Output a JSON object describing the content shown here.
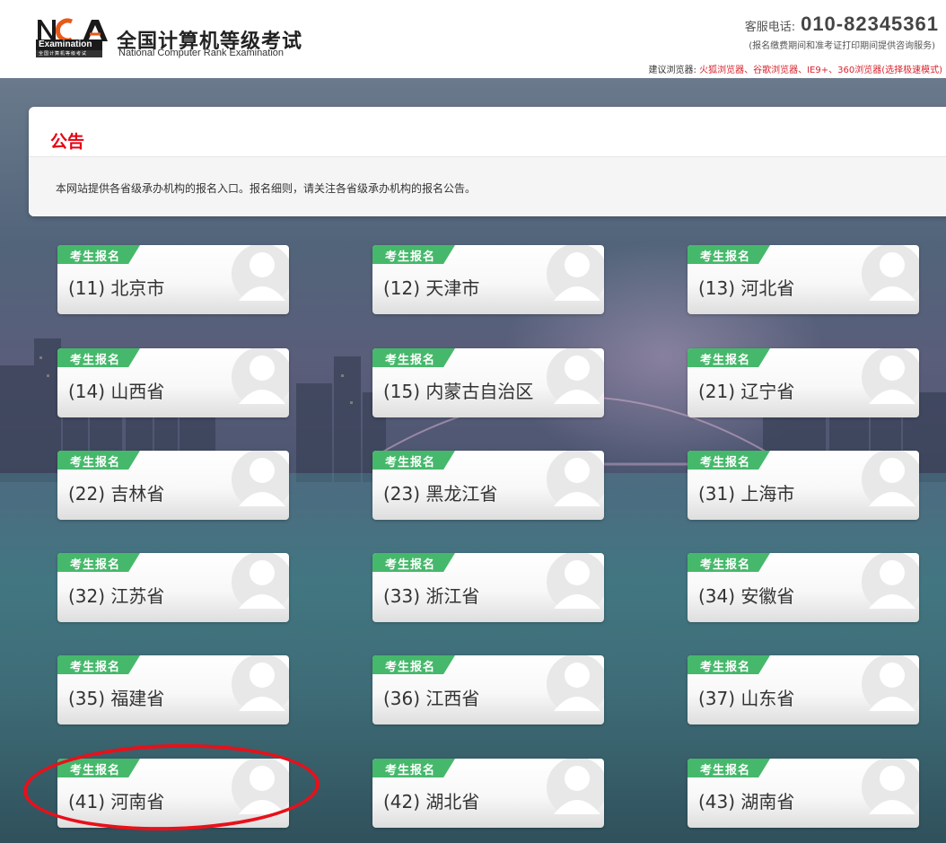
{
  "header": {
    "logo_text": "NCR",
    "logo_exam": "Examination",
    "logo_sub": "全国计算机等级考试",
    "title": "全国计算机等级考试",
    "subtitle": "National Computer Rank Examination",
    "hotline_label": "客服电话:",
    "hotline_number": "010-82345361",
    "hotline_note": "(报名缴费期间和准考证打印期间提供咨询服务)",
    "browser_tip_label": "建议浏览器:",
    "browser_tip_list": "火狐浏览器、谷歌浏览器、IE9+、360浏览器(选择极速模式)"
  },
  "notice": {
    "title": "公告",
    "text": "本网站提供各省级承办机构的报名入口。报名细则，请关注各省级承办机构的报名公告。"
  },
  "card_badge": "考生报名",
  "provinces": [
    {
      "label": "(11) 北京市"
    },
    {
      "label": "(12) 天津市"
    },
    {
      "label": "(13) 河北省"
    },
    {
      "label": "(14) 山西省"
    },
    {
      "label": "(15) 内蒙古自治区"
    },
    {
      "label": "(21) 辽宁省"
    },
    {
      "label": "(22) 吉林省"
    },
    {
      "label": "(23) 黑龙江省"
    },
    {
      "label": "(31) 上海市"
    },
    {
      "label": "(32) 江苏省"
    },
    {
      "label": "(33) 浙江省"
    },
    {
      "label": "(34) 安徽省"
    },
    {
      "label": "(35) 福建省"
    },
    {
      "label": "(36) 江西省"
    },
    {
      "label": "(37) 山东省"
    },
    {
      "label": "(41) 河南省"
    },
    {
      "label": "(42) 湖北省"
    },
    {
      "label": "(43) 湖南省"
    }
  ],
  "colors": {
    "accent_red": "#e60012",
    "badge_green": "#46b86b",
    "annotation_red": "#e8101a"
  }
}
